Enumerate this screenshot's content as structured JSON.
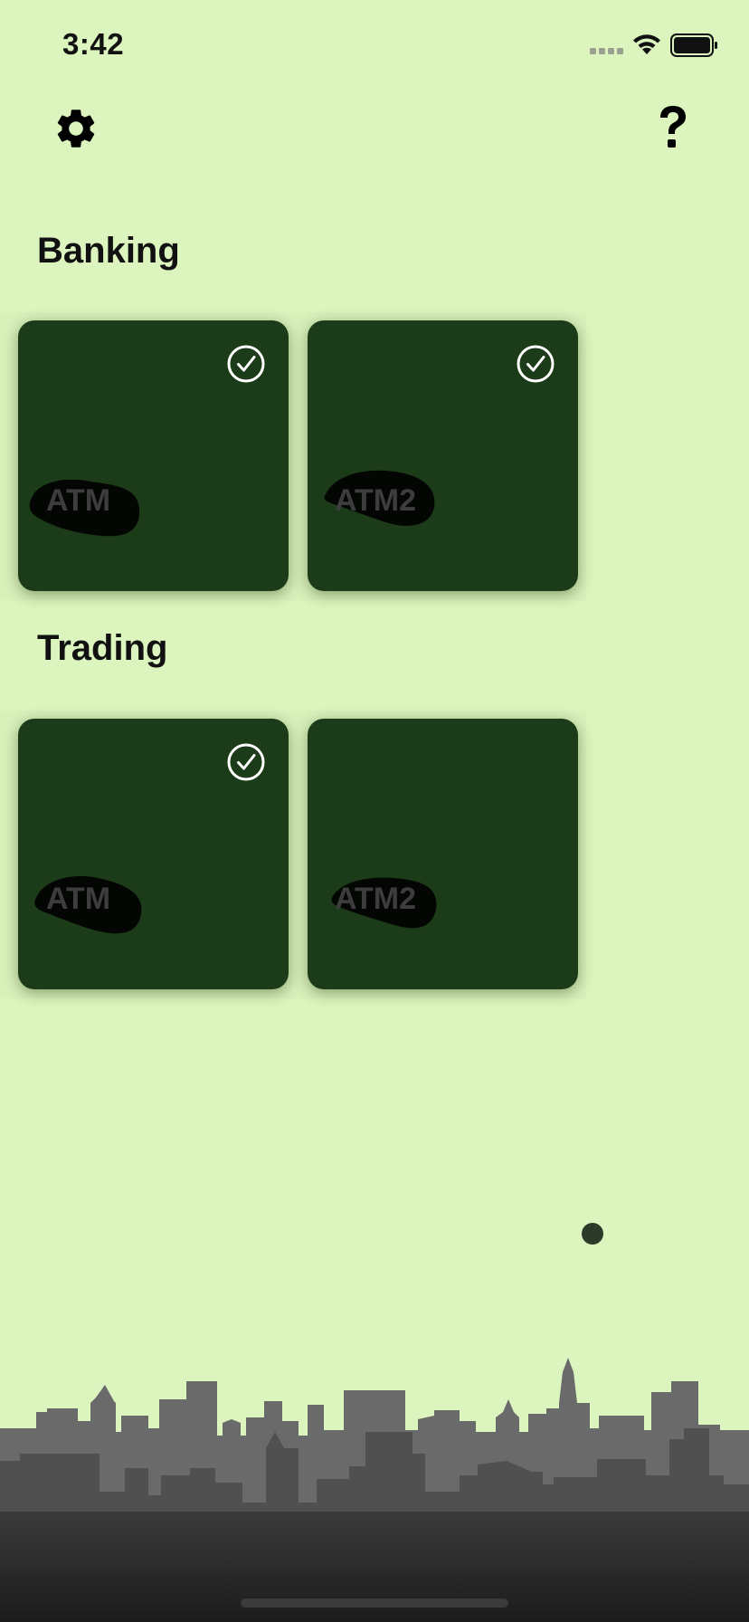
{
  "status_bar": {
    "time": "3:42",
    "signal_icon": "cellular-signal-icon",
    "wifi_icon": "wifi-icon",
    "battery_icon": "battery-full-icon"
  },
  "toolbar": {
    "settings_icon": "gear-icon",
    "help_icon": "question-mark-icon"
  },
  "sections": [
    {
      "title": "Banking",
      "cards": [
        {
          "label": "ATM",
          "checked": true
        },
        {
          "label": "ATM2",
          "checked": true
        }
      ]
    },
    {
      "title": "Trading",
      "cards": [
        {
          "label": "ATM",
          "checked": true
        },
        {
          "label": "ATM2",
          "checked": false
        }
      ]
    }
  ],
  "colors": {
    "background": "#dcf4bd",
    "card": "#1c3b18",
    "card_label": "#3d3d3d",
    "skyline_front": "#505050",
    "skyline_back": "#6a6a6a"
  },
  "pager": {
    "page_count": 1,
    "current_page": 1
  }
}
